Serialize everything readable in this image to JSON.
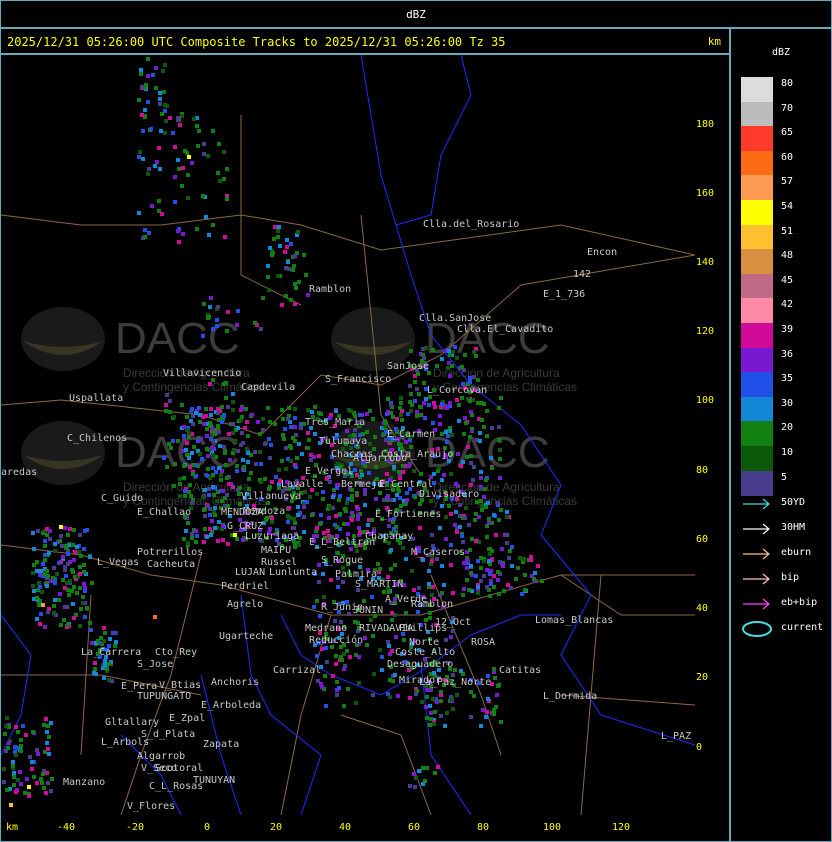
{
  "window_title": "dBZ",
  "header": {
    "title": "2025/12/31 05:26:00 UTC Composite Tracks to 2025/12/31 05:26:00 Tz 35",
    "unit": "km"
  },
  "axes": {
    "x_unit": "km",
    "x_ticks": [
      "-40",
      "-20",
      "0",
      "20",
      "40",
      "60",
      "80",
      "100",
      "120"
    ],
    "y_ticks": [
      "180",
      "160",
      "140",
      "120",
      "100",
      "80",
      "60",
      "40",
      "20",
      "0"
    ]
  },
  "legend": {
    "title": "dBZ",
    "scale": [
      {
        "label": "80",
        "color": "#dcdcdc"
      },
      {
        "label": "70",
        "color": "#bcbcbc"
      },
      {
        "label": "65",
        "color": "#ff3a2a"
      },
      {
        "label": "60",
        "color": "#ff6a14"
      },
      {
        "label": "57",
        "color": "#ff9a52"
      },
      {
        "label": "54",
        "color": "#ffff00"
      },
      {
        "label": "51",
        "color": "#ffc030"
      },
      {
        "label": "48",
        "color": "#d89040"
      },
      {
        "label": "45",
        "color": "#c06a86"
      },
      {
        "label": "42",
        "color": "#ff8aa8"
      },
      {
        "label": "39",
        "color": "#d20a9a"
      },
      {
        "label": "36",
        "color": "#7818d0"
      },
      {
        "label": "35",
        "color": "#2050e8"
      },
      {
        "label": "30",
        "color": "#1488d8"
      },
      {
        "label": "20",
        "color": "#108010"
      },
      {
        "label": "10",
        "color": "#0a5a0a"
      },
      {
        "label": "5",
        "color": "#483c8c"
      }
    ],
    "tracks": [
      {
        "label": "50YD",
        "color": "#40e0e0"
      },
      {
        "label": "30HM",
        "color": "#ffffff"
      },
      {
        "label": "eburn",
        "color": "#ffc080"
      },
      {
        "label": "bip",
        "color": "#ffc0c0"
      },
      {
        "label": "eb+bip",
        "color": "#ff40ff"
      },
      {
        "label": "current",
        "color": "#40e0e0"
      }
    ]
  },
  "watermark": {
    "brand": "DACC",
    "line1": "Dirección de Agricultura",
    "line2": "y Contingencias Climáticas"
  },
  "places": [
    "Clla.del_Rosario",
    "Encon",
    "142",
    "E_1_736",
    "Ramblon",
    "Clla.SanJose",
    "Clla.El_Cavadito",
    "Villavicencio",
    "Uspallata",
    "Capdevila",
    "S_Francisco",
    "SanJose",
    "L_Corcovan",
    "C_Chilenos",
    "Tres_Maria",
    "Tulumaya",
    "E_Carmen",
    "Chacras",
    "Algarrobo",
    "E_Vergel",
    "Costa_Araujo",
    "Lavalle",
    "Bermejo",
    "E_Central",
    "Divisadero",
    "C_Guido",
    "Villanueva",
    "Mendoza",
    "E_Challao",
    "MENDOZA",
    "E_Fortienes",
    "G_CRUZ",
    "Luzuriaga",
    "Chapanay",
    "Potrerillos",
    "L_Vegas",
    "Cacheuta",
    "MAIPU",
    "Russel",
    "LUJAN",
    "Lunlunta",
    "E_L_Beltran",
    "Palmira",
    "S_Roque",
    "M_Caseros",
    "Perdriel",
    "Agrelo",
    "S_MARTIN",
    "A_Verde",
    "Ramblon",
    "Ugarteche",
    "R_Junin",
    "JUNIN",
    "Medrano",
    "Reducción",
    "RIVADAVIA",
    "Phillips",
    "Norte",
    "12_Oct",
    "La_Paz_Norte",
    "ROSA",
    "Lomas_Blancas",
    "Catitas",
    "Carrizal",
    "Anchoris",
    "Cto_Rey",
    "S_Jose",
    "La_Carrera",
    "V_Btias",
    "E_Pera",
    "TUPUNGATO",
    "E_Arboleda",
    "Gltallary",
    "E_Zpal",
    "S_d_Plata",
    "L_Arbols",
    "Algarrob",
    "Zapata",
    "Scotoral",
    "V_Seco",
    "TUNUYAN",
    "Manzano",
    "C_L_Rosas",
    "V_Flores",
    "L_Dormida",
    "L_PAZ",
    "Coste_Alto",
    "Mirador",
    "Desaguadero",
    "aredas"
  ],
  "colors": {
    "border": "#66aabb",
    "header_text": "#ffff00",
    "boundary": "#1c2cff",
    "roads": "#8a6a40",
    "place_text": "#c8c8c8"
  }
}
